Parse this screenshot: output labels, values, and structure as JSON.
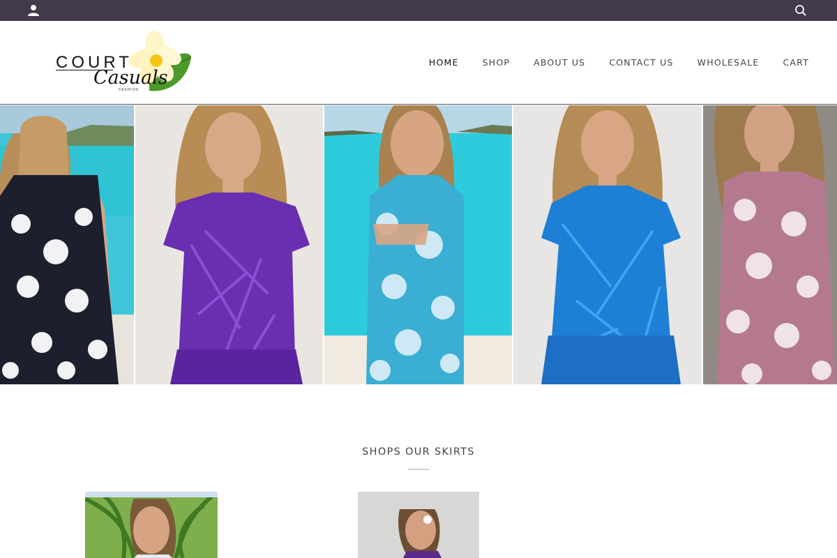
{
  "topbar": {
    "account_icon": "user-icon",
    "search_icon": "search-icon",
    "background": "#42394a"
  },
  "logo": {
    "line1": "COURT",
    "line2": "Casuals",
    "line3": "FASHION",
    "flower_icon": "plumeria-flower-icon"
  },
  "nav": {
    "items": [
      {
        "label": "HOME"
      },
      {
        "label": "SHOP"
      },
      {
        "label": "ABOUT US"
      },
      {
        "label": "CONTACT US"
      },
      {
        "label": "WHOLESALE"
      },
      {
        "label": "CART"
      }
    ]
  },
  "hero": {
    "panels": [
      {
        "name": "black-white-floral-dress-back",
        "dress_color": "#1d1f2e",
        "bg": "#3cc3d6"
      },
      {
        "name": "purple-palm-dress",
        "dress_color": "#6a2fb0",
        "bg": "#e9e6e2"
      },
      {
        "name": "turquoise-floral-dress",
        "dress_color": "#3aaed3",
        "bg": "#2dcbdc"
      },
      {
        "name": "blue-palm-dress",
        "dress_color": "#1e7fd6",
        "bg": "#e8e6e4"
      },
      {
        "name": "mauve-floral-dress",
        "dress_color": "#b5798f",
        "bg": "#8f8a84"
      }
    ]
  },
  "section": {
    "title": "SHOPS OUR SKIRTS"
  },
  "products": [
    {
      "name": "product-image-1"
    },
    {
      "name": "product-image-2"
    }
  ]
}
